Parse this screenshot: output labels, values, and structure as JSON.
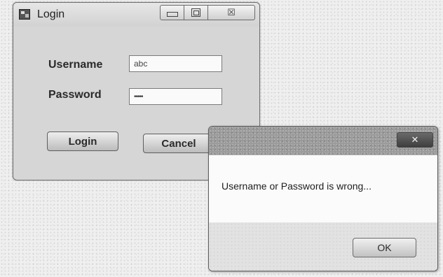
{
  "login_window": {
    "title": "Login",
    "icon": "app-icon",
    "controls": {
      "minimize_icon": "minimize-icon",
      "maximize_icon": "maximize-icon",
      "close_glyph": "☒"
    },
    "username_label": "Username",
    "username_value": "abc",
    "password_label": "Password",
    "password_value": "•••••",
    "login_button": "Login",
    "cancel_button": "Cancel"
  },
  "message_box": {
    "close_glyph": "✕",
    "message": "Username or Password is wrong...",
    "ok_button": "OK"
  }
}
